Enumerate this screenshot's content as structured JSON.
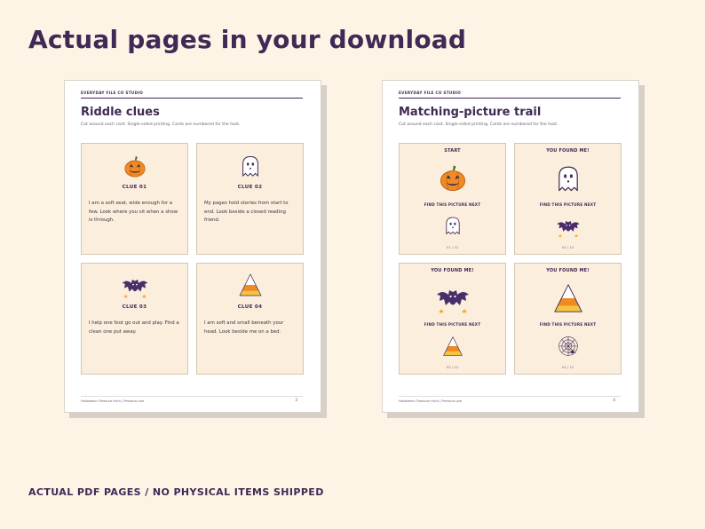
{
  "headline": "Actual pages in your download",
  "footer_note": "ACTUAL PDF PAGES / NO PHYSICAL ITEMS SHIPPED",
  "colors": {
    "brand": "#3f2a55",
    "background": "#fdf4e6",
    "card": "#fbeedd",
    "pumpkin": "#f08a24",
    "candy_yellow": "#f5c542"
  },
  "riddle_page": {
    "studio": "EVERYDAY FILE CO STUDIO",
    "title": "Riddle clues",
    "subtitle": "Cut around each card. Single-sided printing. Cards are numbered for the host.",
    "cards": [
      {
        "icon": "pumpkin-icon",
        "label": "CLUE 01",
        "text": "I am a soft seat, wide enough for a few. Look where you sit when a show is through."
      },
      {
        "icon": "ghost-icon",
        "label": "CLUE 02",
        "text": "My pages hold stories from start to end. Look beside a closed reading friend."
      },
      {
        "icon": "bat-icon",
        "label": "CLUE 03",
        "text": "I help one foot go out and play. Find a clean one put away."
      },
      {
        "icon": "candy-corn-icon",
        "label": "CLUE 04",
        "text": "I am soft and small beneath your head. Look beside me on a bed."
      }
    ],
    "footer": "Halloween Treasure Hunt | Personal use",
    "page_number": "3"
  },
  "picture_page": {
    "studio": "EVERYDAY FILE CO STUDIO",
    "title": "Matching-picture trail",
    "subtitle": "Cut around each card. Single-sided printing. Cards are numbered for the host.",
    "cards": [
      {
        "heading": "START",
        "main_icon": "pumpkin-icon",
        "find_label": "FIND THIS PICTURE NEXT",
        "next_icon": "ghost-icon",
        "number": "01 / 12"
      },
      {
        "heading": "YOU FOUND ME!",
        "main_icon": "ghost-icon",
        "find_label": "FIND THIS PICTURE NEXT",
        "next_icon": "bat-icon",
        "number": "02 / 12"
      },
      {
        "heading": "YOU FOUND ME!",
        "main_icon": "bat-icon",
        "find_label": "FIND THIS PICTURE NEXT",
        "next_icon": "candy-corn-icon",
        "number": "03 / 12"
      },
      {
        "heading": "YOU FOUND ME!",
        "main_icon": "candy-corn-icon",
        "find_label": "FIND THIS PICTURE NEXT",
        "next_icon": "spider-web-icon",
        "number": "04 / 12"
      }
    ],
    "footer": "Halloween Treasure Hunt | Personal use",
    "page_number": "4"
  }
}
